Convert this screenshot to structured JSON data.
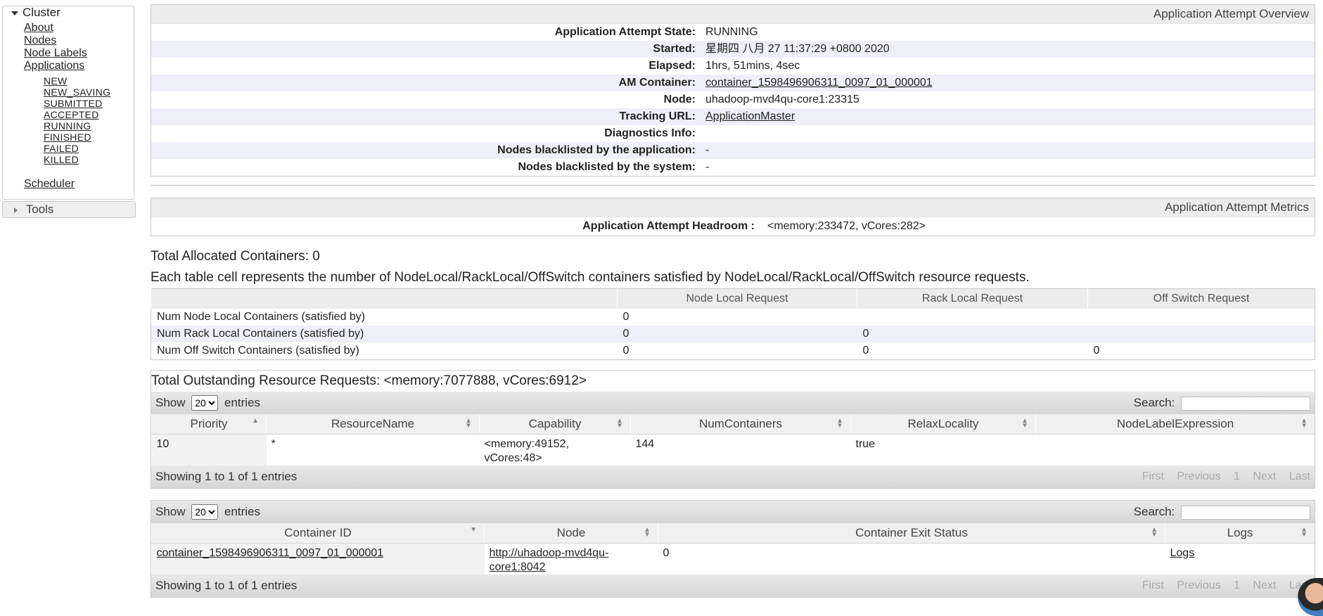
{
  "sidebar": {
    "cluster_title": "Cluster",
    "items": [
      "About",
      "Nodes",
      "Node Labels",
      "Applications"
    ],
    "app_states": [
      "NEW",
      "NEW_SAVING",
      "SUBMITTED",
      "ACCEPTED",
      "RUNNING",
      "FINISHED",
      "FAILED",
      "KILLED"
    ],
    "scheduler": "Scheduler",
    "tools_title": "Tools"
  },
  "overview": {
    "title": "Application Attempt Overview",
    "rows": [
      {
        "label": "Application Attempt State:",
        "value": "RUNNING"
      },
      {
        "label": "Started:",
        "value": "星期四 八月 27 11:37:29 +0800 2020"
      },
      {
        "label": "Elapsed:",
        "value": "1hrs, 51mins, 4sec"
      },
      {
        "label": "AM Container:",
        "value": "container_1598496906311_0097_01_000001"
      },
      {
        "label": "Node:",
        "value": "uhadoop-mvd4qu-core1:23315"
      },
      {
        "label": "Tracking URL:",
        "value": "ApplicationMaster"
      },
      {
        "label": "Diagnostics Info:",
        "value": ""
      },
      {
        "label": "Nodes blacklisted by the application:",
        "value": "-"
      },
      {
        "label": "Nodes blacklisted by the system:",
        "value": "-"
      }
    ]
  },
  "metrics": {
    "title": "Application Attempt Metrics",
    "headroom_label": "Application Attempt Headroom :",
    "headroom_value": "<memory:233472, vCores:282>"
  },
  "allocation": {
    "total": "Total Allocated Containers: 0",
    "description": "Each table cell represents the number of NodeLocal/RackLocal/OffSwitch containers satisfied by NodeLocal/RackLocal/OffSwitch resource requests.",
    "headers": [
      "",
      "Node Local Request",
      "Rack Local Request",
      "Off Switch Request"
    ],
    "rows": [
      {
        "label": "Num Node Local Containers (satisfied by)",
        "cells": [
          "0",
          "",
          ""
        ]
      },
      {
        "label": "Num Rack Local Containers (satisfied by)",
        "cells": [
          "0",
          "0",
          ""
        ]
      },
      {
        "label": "Num Off Switch Containers (satisfied by)",
        "cells": [
          "0",
          "0",
          "0"
        ]
      }
    ]
  },
  "outstanding": {
    "title": "Total Outstanding Resource Requests: <memory:7077888, vCores:6912>",
    "show_label": "Show",
    "page_size": "20",
    "entries_label": "entries",
    "search_label": "Search:",
    "headers": [
      "Priority",
      "ResourceName",
      "Capability",
      "NumContainers",
      "RelaxLocality",
      "NodeLabelExpression"
    ],
    "row": {
      "priority": "10",
      "resource": "*",
      "capability": "<memory:49152, vCores:48>",
      "num": "144",
      "relax": "true",
      "label_expr": ""
    },
    "showing": "Showing 1 to 1 of 1 entries",
    "pager": [
      "First",
      "Previous",
      "1",
      "Next",
      "Last"
    ]
  },
  "containers": {
    "show_label": "Show",
    "page_size": "20",
    "entries_label": "entries",
    "search_label": "Search:",
    "headers": [
      "Container ID",
      "Node",
      "Container Exit Status",
      "Logs"
    ],
    "row": {
      "id": "container_1598496906311_0097_01_000001",
      "node": "http://uhadoop-mvd4qu-core1:8042",
      "exit": "0",
      "logs": "Logs"
    },
    "showing": "Showing 1 to 1 of 1 entries",
    "pager": [
      "First",
      "Previous",
      "1",
      "Next",
      "Last"
    ]
  }
}
